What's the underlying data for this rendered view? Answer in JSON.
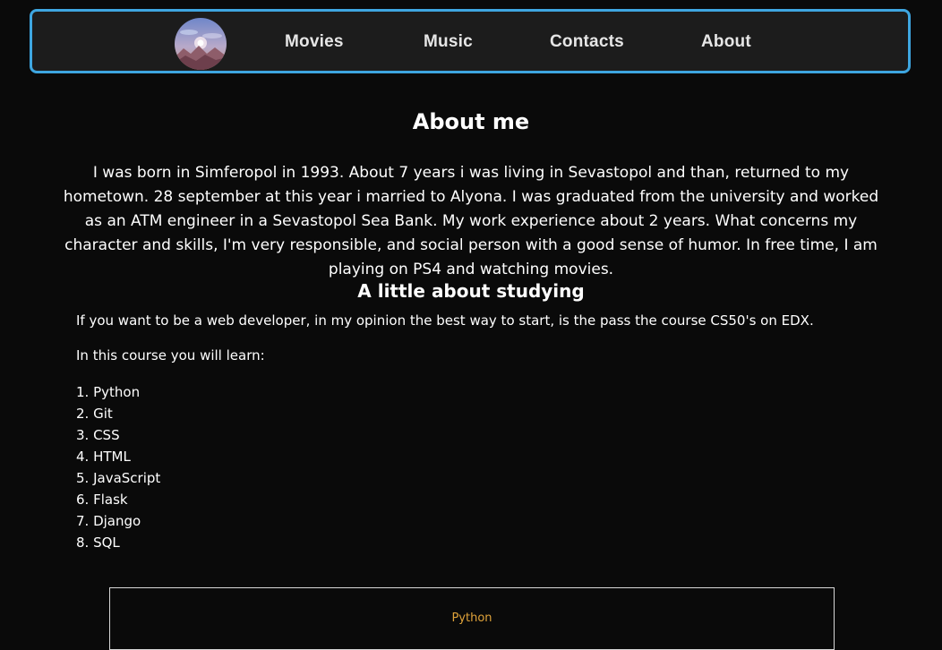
{
  "nav": {
    "logo_icon": "mountain-sun-logo-icon",
    "links": [
      "Movies",
      "Music",
      "Contacts",
      "About"
    ],
    "border_color": "#3ea6e0"
  },
  "about": {
    "title": "About me",
    "text": "I was born in Simferopol in 1993. About 7 years i was living in Sevastopol and than, returned to my hometown. 28 september at this year i married to Alyona. I was graduated from the university and worked as an ATM engineer in a Sevastopol Sea Bank. My work experience about 2 years. What concerns my character and skills, I'm very responsible, and social person with a good sense of humor. In free time, I am playing on PS4 and watching movies."
  },
  "study": {
    "title": "A little about studying",
    "intro": "If you want to be a web developer, in my opinion the best way to start, is the pass the course CS50's on EDX.",
    "learn_label": "In this course you will learn:",
    "items": [
      "1. Python",
      "2. Git",
      "3. CSS",
      "4. HTML",
      "5. JavaScript",
      "6. Flask",
      "7. Django",
      "8. SQL"
    ]
  },
  "box": {
    "title": "Python",
    "title_color": "#e0a33a"
  }
}
